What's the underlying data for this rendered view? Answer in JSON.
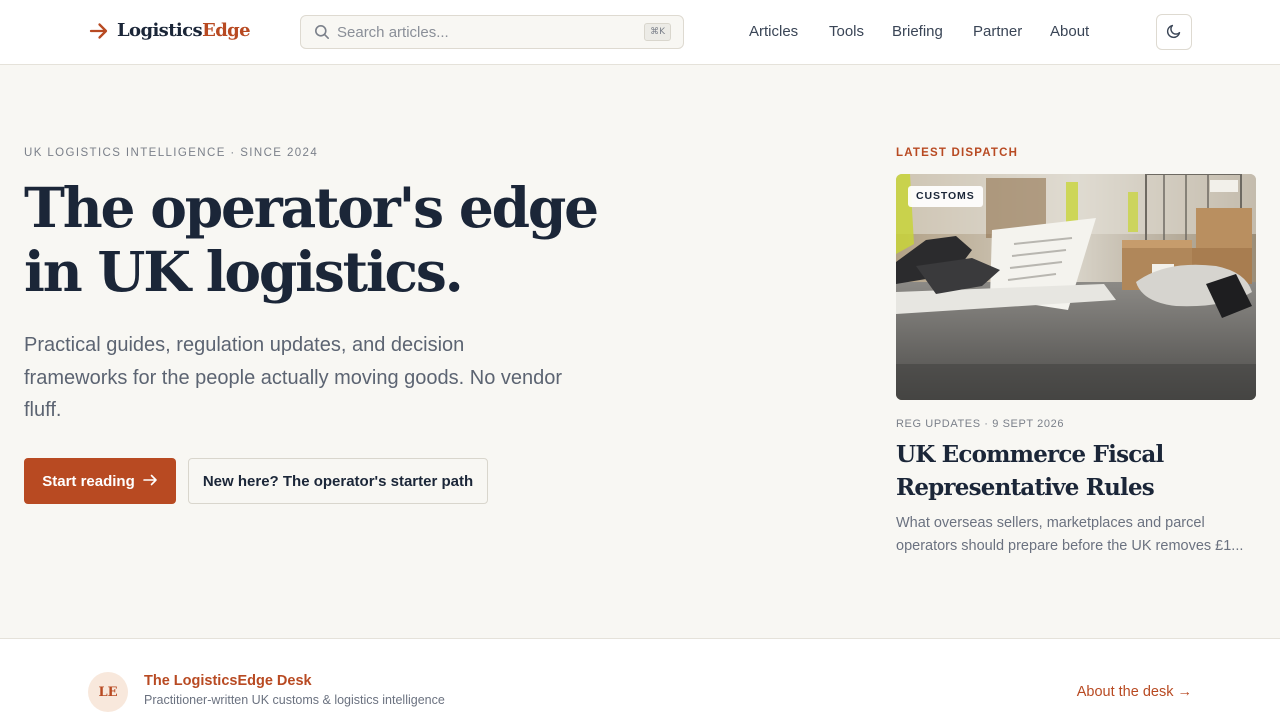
{
  "brand": {
    "name_primary": "Logistics",
    "name_accent": "Edge",
    "accent_color": "#b84a22",
    "logo_icon": "arrow-right-icon"
  },
  "search": {
    "placeholder": "Search articles...",
    "value": "",
    "shortcut": "⌘K",
    "icon": "search-icon"
  },
  "nav": {
    "items": [
      {
        "label": "Articles"
      },
      {
        "label": "Tools"
      },
      {
        "label": "Briefing"
      },
      {
        "label": "Partner"
      },
      {
        "label": "About"
      }
    ]
  },
  "theme_toggle": {
    "icon": "moon-icon"
  },
  "hero": {
    "eyebrow": "UK LOGISTICS INTELLIGENCE · SINCE 2024",
    "headline": "The operator's edge in UK logistics.",
    "subcopy": "Practical guides, regulation updates, and decision frameworks for the people actually moving goods. No vendor fluff.",
    "primary_cta": "Start reading",
    "secondary_cta": "New here? The operator's starter path"
  },
  "latest": {
    "label": "LATEST DISPATCH",
    "tag": "CUSTOMS",
    "meta": "REG UPDATES · 9 SEPT 2026",
    "title": "UK Ecommerce Fiscal Representative Rules",
    "excerpt": "What overseas sellers, marketplaces and parcel operators should prepare before the UK removes £1..."
  },
  "desk": {
    "initials": "LE",
    "name": "The LogisticsEdge Desk",
    "description": "Practitioner-written UK customs & logistics intelligence",
    "link": "About the desk →"
  }
}
